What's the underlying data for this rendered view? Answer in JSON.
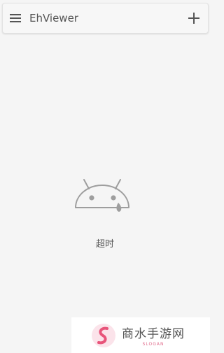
{
  "toolbar": {
    "title": "EhViewer",
    "menu_icon": "hamburger-menu-icon",
    "add_icon": "plus-icon"
  },
  "content": {
    "status_icon": "sad-android-icon",
    "message": "超时"
  },
  "watermark": {
    "name": "商水手游网",
    "slogan": "SLOGAN",
    "accent_color": "#e8547a"
  },
  "colors": {
    "background": "#f5f5f5",
    "toolbar_bg": "#f7f7f7",
    "text": "#555555",
    "icon": "#9e9e9e"
  }
}
